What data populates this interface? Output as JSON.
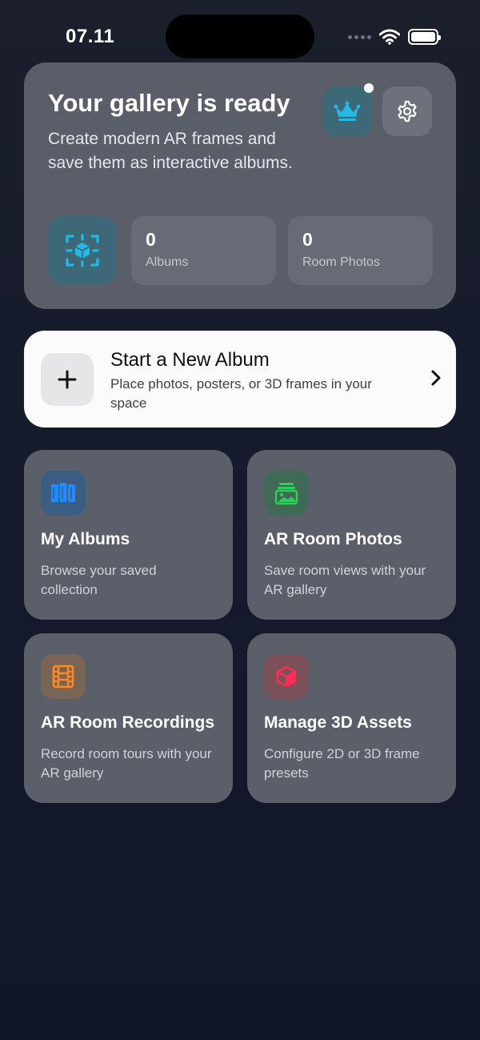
{
  "status_bar": {
    "time": "07.11"
  },
  "hero": {
    "title": "Your gallery is ready",
    "description": "Create modern AR frames and save them as interactive albums.",
    "stats": [
      {
        "value": "0",
        "label": "Albums"
      },
      {
        "value": "0",
        "label": "Room Photos"
      }
    ]
  },
  "new_album": {
    "title": "Start a New Album",
    "subtitle": "Place photos, posters, or 3D frames in your space"
  },
  "features": [
    {
      "title": "My Albums",
      "subtitle": "Browse your saved collection",
      "icon": "albums-icon",
      "color": "#1e8cff"
    },
    {
      "title": "AR Room Photos",
      "subtitle": "Save room views with your AR gallery",
      "icon": "photo-stack-icon",
      "color": "#2fd05a"
    },
    {
      "title": "AR Room Recordings",
      "subtitle": "Record room tours with your AR gallery",
      "icon": "film-icon",
      "color": "#ff8a1f"
    },
    {
      "title": "Manage 3D Assets",
      "subtitle": "Configure 2D or 3D frame presets",
      "icon": "cube-icon",
      "color": "#ff2d55"
    }
  ],
  "colors": {
    "accent": "#22b8e8",
    "background": "#141a2c"
  }
}
